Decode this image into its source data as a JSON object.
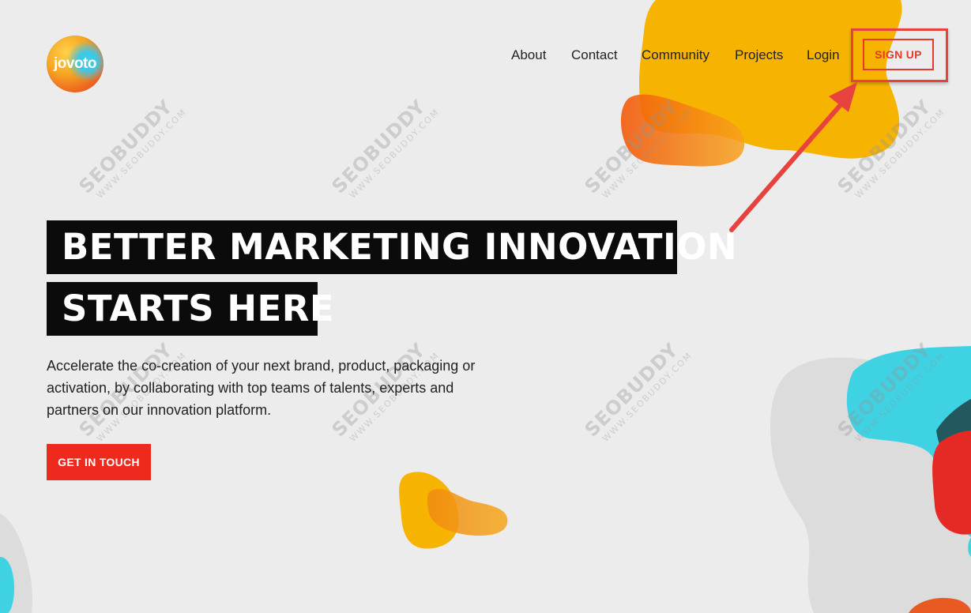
{
  "logo": {
    "text": "jovoto"
  },
  "nav": {
    "links": [
      {
        "label": "About"
      },
      {
        "label": "Contact"
      },
      {
        "label": "Community"
      },
      {
        "label": "Projects"
      },
      {
        "label": "Login"
      }
    ],
    "signup_label": "SIGN UP"
  },
  "hero": {
    "headline_line1": "BETTER MARKETING INNOVATION",
    "headline_line2": "STARTS HERE",
    "description": "Accelerate the co-creation of your next brand, product, packaging or activation, by collaborating with top teams of talents, experts and partners on our innovation platform.",
    "cta_label": "GET IN TOUCH"
  },
  "watermark": {
    "brand": "SEOBUDDY",
    "url": "WWW.SEOBUDDY.COM"
  },
  "colors": {
    "accent": "#ee2a1e",
    "annotation": "#e8423f",
    "blob_yellow": "#f6b400",
    "blob_orange": "#f07a10",
    "blob_cyan": "#3fd2e3",
    "blob_red": "#e52a25",
    "blob_gray": "#d9d9d9"
  }
}
